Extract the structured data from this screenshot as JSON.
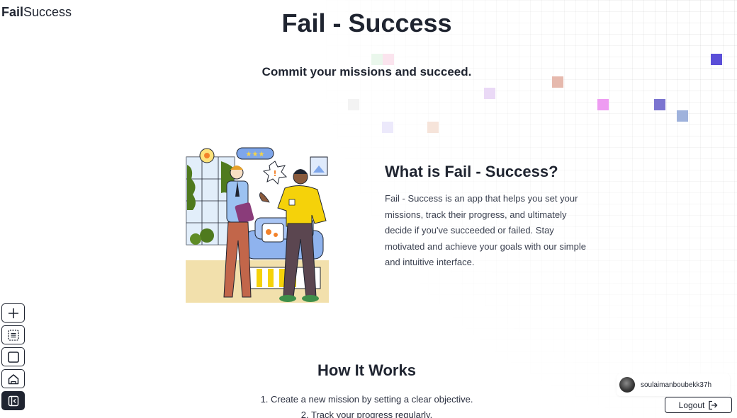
{
  "brand": {
    "bold": "Fail",
    "regular": "Success"
  },
  "hero": {
    "title": "Fail - Success",
    "subtitle": "Commit your missions and succeed."
  },
  "about": {
    "title": "What is Fail - Success?",
    "description": "Fail - Success is an app that helps you set your missions, track their progress, and ultimately decide if you've succeeded or failed. Stay motivated and achieve your goals with our simple and intuitive interface."
  },
  "how_it_works": {
    "title": "How It Works",
    "steps": [
      "1. Create a new mission by setting a clear objective.",
      "2. Track your progress regularly."
    ]
  },
  "side_nav": {
    "items": [
      {
        "icon": "plus-icon"
      },
      {
        "icon": "list-icon"
      },
      {
        "icon": "square-icon"
      },
      {
        "icon": "home-icon"
      },
      {
        "icon": "sidebar-collapse-icon",
        "active": true
      }
    ]
  },
  "user": {
    "username": "soulaimanboubekk37h"
  },
  "logout": {
    "label": "Logout",
    "icon": "logout-icon"
  },
  "colors": {
    "text": "#1f2430",
    "accent_squares": [
      "#5b4fd8",
      "#e79bf0",
      "#7b74d0",
      "#9fb2dc",
      "#e2b8ae",
      "#e8d9f4",
      "#f6e6dd"
    ]
  }
}
